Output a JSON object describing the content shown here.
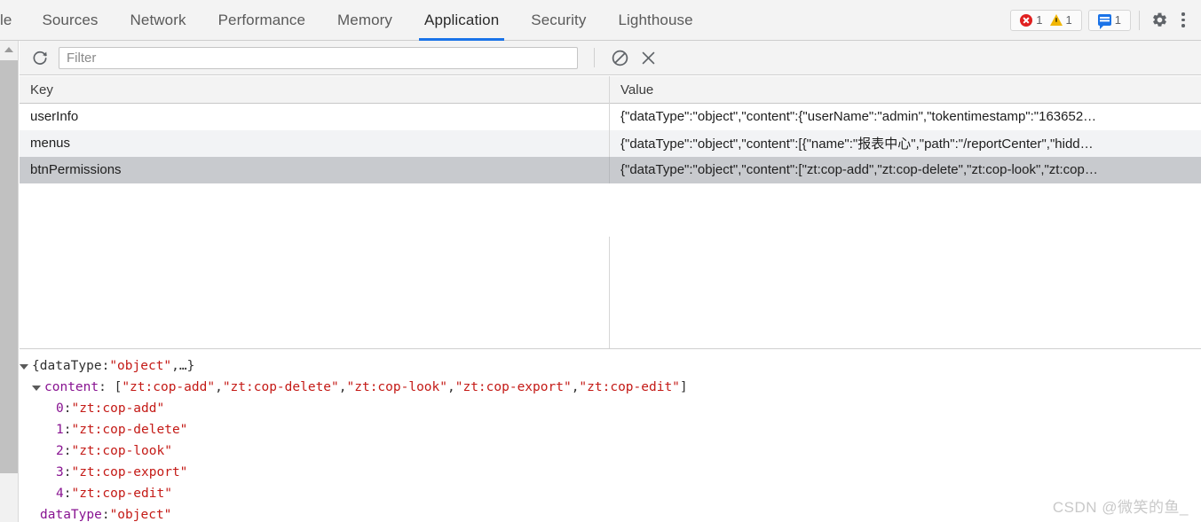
{
  "devtools": {
    "tabs": [
      {
        "label": "le",
        "active": false,
        "clipped": true
      },
      {
        "label": "Sources",
        "active": false
      },
      {
        "label": "Network",
        "active": false
      },
      {
        "label": "Performance",
        "active": false
      },
      {
        "label": "Memory",
        "active": false
      },
      {
        "label": "Application",
        "active": true
      },
      {
        "label": "Security",
        "active": false
      },
      {
        "label": "Lighthouse",
        "active": false
      }
    ],
    "status": {
      "errors": "1",
      "warnings": "1",
      "messages": "1"
    },
    "icons": {
      "error": "error-circle-icon",
      "warning": "warning-triangle-icon",
      "message": "message-bubble-icon",
      "settings": "gear-icon",
      "more": "kebab-menu-icon"
    },
    "accent_color": "#1a73e8"
  },
  "toolbar": {
    "refresh_label": "refresh-icon",
    "filter": {
      "value": "",
      "placeholder": "Filter"
    },
    "clear_all_label": "clear-all-icon",
    "delete_selected_label": "delete-selected-icon"
  },
  "table": {
    "columns": [
      "Key",
      "Value"
    ],
    "rows": [
      {
        "key": "userInfo",
        "value": "{\"dataType\":\"object\",\"content\":{\"userName\":\"admin\",\"tokentimestamp\":\"163652…",
        "selected": false
      },
      {
        "key": "menus",
        "value": "{\"dataType\":\"object\",\"content\":[{\"name\":\"报表中心\",\"path\":\"/reportCenter\",\"hidd…",
        "selected": false
      },
      {
        "key": "btnPermissions",
        "value": "{\"dataType\":\"object\",\"content\":[\"zt:cop-add\",\"zt:cop-delete\",\"zt:cop-look\",\"zt:cop…",
        "selected": true
      }
    ]
  },
  "preview": {
    "lines": [
      {
        "indent": 0,
        "twisty": "open",
        "parts": [
          {
            "text": "{dataType: ",
            "cls": "k-plain"
          },
          {
            "text": "\"object\"",
            "cls": "k-str"
          },
          {
            "text": ",…}",
            "cls": "k-plain"
          }
        ]
      },
      {
        "indent": 1,
        "twisty": "open",
        "parts": [
          {
            "text": "content",
            "cls": "k-prop"
          },
          {
            "text": ": [",
            "cls": "k-plain"
          },
          {
            "text": "\"zt:cop-add\"",
            "cls": "k-str"
          },
          {
            "text": ", ",
            "cls": "k-plain"
          },
          {
            "text": "\"zt:cop-delete\"",
            "cls": "k-str"
          },
          {
            "text": ", ",
            "cls": "k-plain"
          },
          {
            "text": "\"zt:cop-look\"",
            "cls": "k-str"
          },
          {
            "text": ", ",
            "cls": "k-plain"
          },
          {
            "text": "\"zt:cop-export\"",
            "cls": "k-str"
          },
          {
            "text": ", ",
            "cls": "k-plain"
          },
          {
            "text": "\"zt:cop-edit\"",
            "cls": "k-str"
          },
          {
            "text": "]",
            "cls": "k-plain"
          }
        ]
      },
      {
        "indent": 2,
        "twisty": "none",
        "parts": [
          {
            "text": "0",
            "cls": "k-idx"
          },
          {
            "text": ": ",
            "cls": "k-plain"
          },
          {
            "text": "\"zt:cop-add\"",
            "cls": "k-str"
          }
        ]
      },
      {
        "indent": 2,
        "twisty": "none",
        "parts": [
          {
            "text": "1",
            "cls": "k-idx"
          },
          {
            "text": ": ",
            "cls": "k-plain"
          },
          {
            "text": "\"zt:cop-delete\"",
            "cls": "k-str"
          }
        ]
      },
      {
        "indent": 2,
        "twisty": "none",
        "parts": [
          {
            "text": "2",
            "cls": "k-idx"
          },
          {
            "text": ": ",
            "cls": "k-plain"
          },
          {
            "text": "\"zt:cop-look\"",
            "cls": "k-str"
          }
        ]
      },
      {
        "indent": 2,
        "twisty": "none",
        "parts": [
          {
            "text": "3",
            "cls": "k-idx"
          },
          {
            "text": ": ",
            "cls": "k-plain"
          },
          {
            "text": "\"zt:cop-export\"",
            "cls": "k-str"
          }
        ]
      },
      {
        "indent": 2,
        "twisty": "none",
        "parts": [
          {
            "text": "4",
            "cls": "k-idx"
          },
          {
            "text": ": ",
            "cls": "k-plain"
          },
          {
            "text": "\"zt:cop-edit\"",
            "cls": "k-str"
          }
        ]
      },
      {
        "indent": 1,
        "twisty": "none",
        "parts": [
          {
            "text": "dataType",
            "cls": "k-prop"
          },
          {
            "text": ": ",
            "cls": "k-plain"
          },
          {
            "text": "\"object\"",
            "cls": "k-str"
          }
        ]
      }
    ]
  },
  "watermark": {
    "text": "CSDN @微笑的鱼_"
  }
}
